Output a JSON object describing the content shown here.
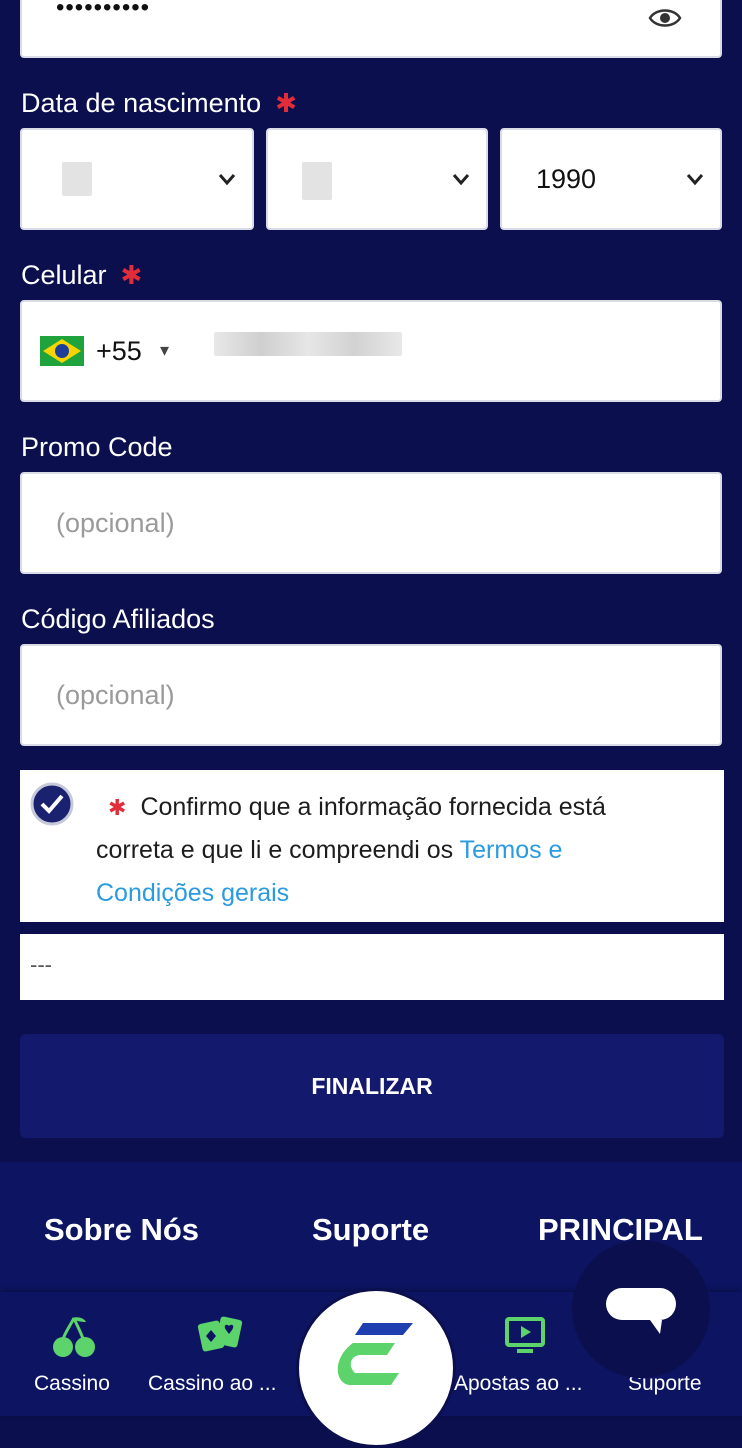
{
  "password": {
    "masked": "••••••••••"
  },
  "birthdate": {
    "label": "Data de nascimento",
    "required_mark": "✱",
    "day": "",
    "month": "",
    "year": "1990"
  },
  "phone": {
    "label": "Celular",
    "required_mark": "✱",
    "country_code": "+55",
    "dropdown_mark": "▾"
  },
  "promo": {
    "label": "Promo Code",
    "placeholder": "(opcional)"
  },
  "affiliate": {
    "label": "Código Afiliados",
    "placeholder": "(opcional)"
  },
  "confirm": {
    "required_mark": "✱",
    "text_line1": "Confirmo que a informação fornecida está",
    "text_line2": "correta e que li e compreendi os",
    "link_part1": "Termos e",
    "link_part2": "Condições gerais"
  },
  "captcha": {
    "value": "---"
  },
  "submit": {
    "label": "FINALIZAR"
  },
  "footer_links": [
    "Sobre Nós",
    "Suporte",
    "PRINCIPAL"
  ],
  "bottom_nav": {
    "items": [
      {
        "label": "Cassino",
        "icon": "cherries-icon"
      },
      {
        "label": "Cassino ao ...",
        "icon": "cards-icon"
      },
      {
        "label": "Apostas ao ...",
        "icon": "tv-play-icon"
      },
      {
        "label": "Suporte",
        "icon": "chat-icon"
      }
    ]
  },
  "colors": {
    "background": "#0b0f4d",
    "button": "#131a6e",
    "link": "#2b9be0",
    "green": "#5cd36b",
    "required": "#e12d39"
  }
}
